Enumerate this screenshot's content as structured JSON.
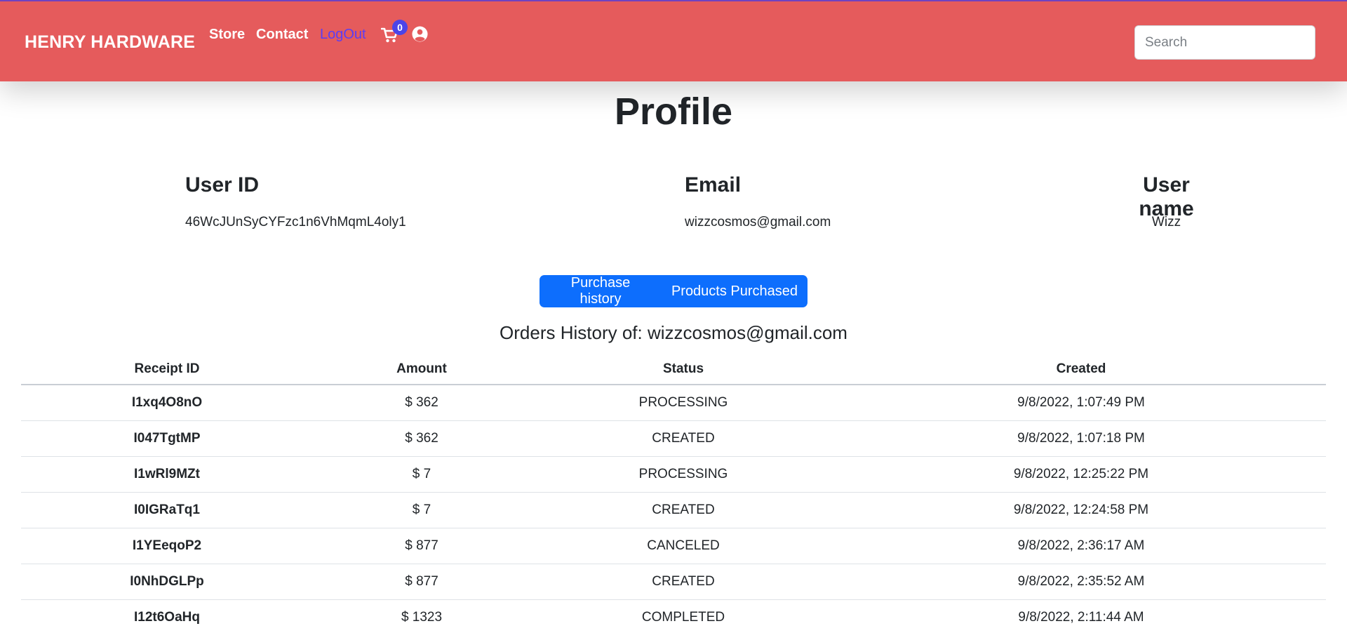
{
  "navbar": {
    "brand": "HENRY HARDWARE",
    "links": {
      "store": "Store",
      "contact": "Contact",
      "logout": "LogOut"
    },
    "cart_count": "0",
    "search_placeholder": "Search",
    "icons": [
      "cart-icon",
      "user-circle-icon"
    ],
    "colors": {
      "background": "#e55b5c",
      "logout": "#5b3df5",
      "badge": "#4b44e8"
    }
  },
  "page": {
    "title": "Profile"
  },
  "profile": {
    "user_id_label": "User ID",
    "user_id_value": "46WcJUnSyCYFzc1n6VhMqmL4oly1",
    "email_label": "Email",
    "email_value": "wizzcosmos@gmail.com",
    "username_label": "User name",
    "username_value": "Wizz"
  },
  "tabs": {
    "purchase_history": "Purchase history",
    "products_purchased": "Products Purchased",
    "color": "#0d6efd"
  },
  "orders": {
    "title": "Orders History of: wizzcosmos@gmail.com",
    "columns": [
      "Receipt ID",
      "Amount",
      "Status",
      "Created"
    ],
    "rows": [
      [
        "I1xq4O8nO",
        "$ 362",
        "PROCESSING",
        "9/8/2022, 1:07:49 PM"
      ],
      [
        "I047TgtMP",
        "$ 362",
        "CREATED",
        "9/8/2022, 1:07:18 PM"
      ],
      [
        "I1wRl9MZt",
        "$ 7",
        "PROCESSING",
        "9/8/2022, 12:25:22 PM"
      ],
      [
        "I0IGRaTq1",
        "$ 7",
        "CREATED",
        "9/8/2022, 12:24:58 PM"
      ],
      [
        "I1YEeqoP2",
        "$ 877",
        "CANCELED",
        "9/8/2022, 2:36:17 AM"
      ],
      [
        "I0NhDGLPp",
        "$ 877",
        "CREATED",
        "9/8/2022, 2:35:52 AM"
      ],
      [
        "I12t6OaHq",
        "$ 1323",
        "COMPLETED",
        "9/8/2022, 2:11:44 AM"
      ]
    ]
  }
}
